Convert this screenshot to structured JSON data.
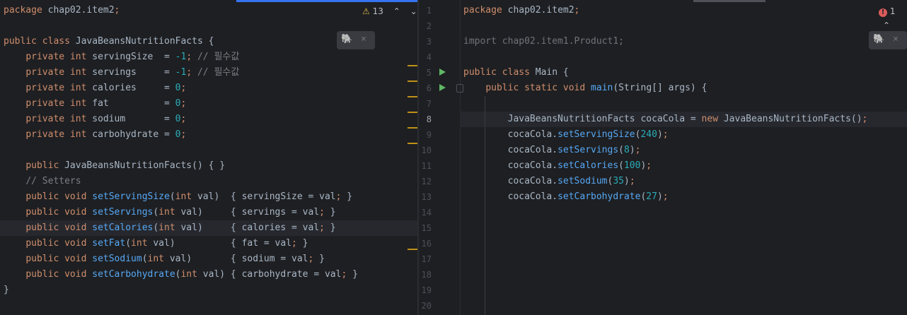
{
  "left": {
    "warnings": {
      "count": "13",
      "up": "^",
      "down": "v",
      "icon": "⚠"
    },
    "lines": [
      "package chap02.item2;",
      "",
      "public class JavaBeansNutritionFacts {",
      "    private int servingSize  = -1; // 필수값",
      "    private int servings     = -1; // 필수값",
      "    private int calories     = 0;",
      "    private int fat          = 0;",
      "    private int sodium       = 0;",
      "    private int carbohydrate = 0;",
      "",
      "    public JavaBeansNutritionFacts() { }",
      "    // Setters",
      "    public void setServingSize(int val)  { servingSize = val; }",
      "    public void setServings(int val)     { servings = val; }",
      "    public void setCalories(int val)     { calories = val; }",
      "    public void setFat(int val)          { fat = val; }",
      "    public void setSodium(int val)       { sodium = val; }",
      "    public void setCarbohydrate(int val) { carbohydrate = val; }",
      "}"
    ]
  },
  "right": {
    "errors": {
      "count": "1",
      "icon": "!"
    },
    "line_numbers": [
      "1",
      "2",
      "3",
      "4",
      "5",
      "6",
      "7",
      "8",
      "9",
      "10",
      "11",
      "12",
      "13",
      "14",
      "15",
      "16",
      "17",
      "18",
      "19",
      "20"
    ],
    "lines": [
      "package chap02.item2;",
      "",
      "import chap02.item1.Product1;",
      "",
      "public class Main {",
      "    public static void main(String[] args) {",
      "",
      "        JavaBeansNutritionFacts cocaCola = new JavaBeansNutritionFacts();",
      "        cocaCola.setServingSize(240);",
      "        cocaCola.setServings(8);",
      "        cocaCola.setCalories(100);",
      "        cocaCola.setSodium(35);",
      "        cocaCola.setCarbohydrate(27);"
    ]
  },
  "widget": {
    "icon": "🐘",
    "close": "×"
  }
}
